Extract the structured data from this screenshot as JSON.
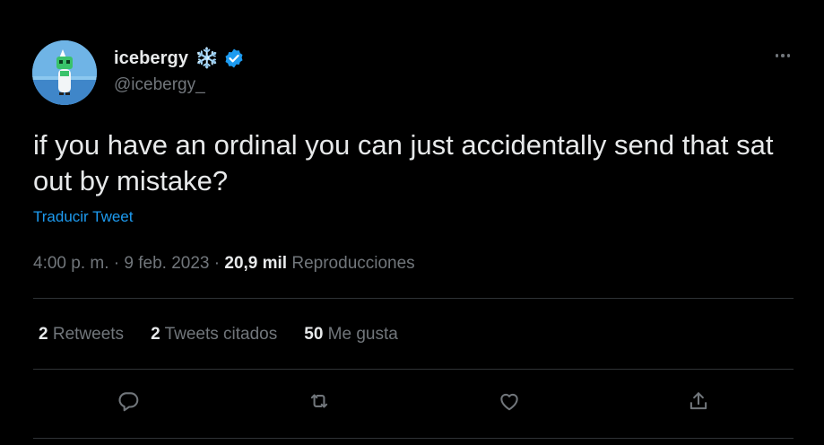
{
  "user": {
    "display_name": "icebergy",
    "emoji": "❄️",
    "handle": "@icebergy_",
    "verified": true,
    "verified_color": "#1d9bf0"
  },
  "tweet": {
    "text": "if you have an ordinal you can just accidentally send that sat out by mistake?",
    "translate_label": "Traducir Tweet"
  },
  "meta": {
    "time": "4:00 p. m.",
    "separator": "·",
    "date": "9 feb. 2023",
    "views_count": "20,9 mil",
    "views_label": "Reproducciones"
  },
  "stats": {
    "retweets_count": "2",
    "retweets_label": "Retweets",
    "quotes_count": "2",
    "quotes_label": "Tweets citados",
    "likes_count": "50",
    "likes_label": "Me gusta"
  },
  "actions": [
    "reply-icon",
    "retweet-icon",
    "like-icon",
    "share-icon"
  ],
  "colors": {
    "background": "#000000",
    "text_primary": "#e7e9ea",
    "text_secondary": "#71767b",
    "accent": "#1d9bf0",
    "divider": "#2f3336"
  }
}
